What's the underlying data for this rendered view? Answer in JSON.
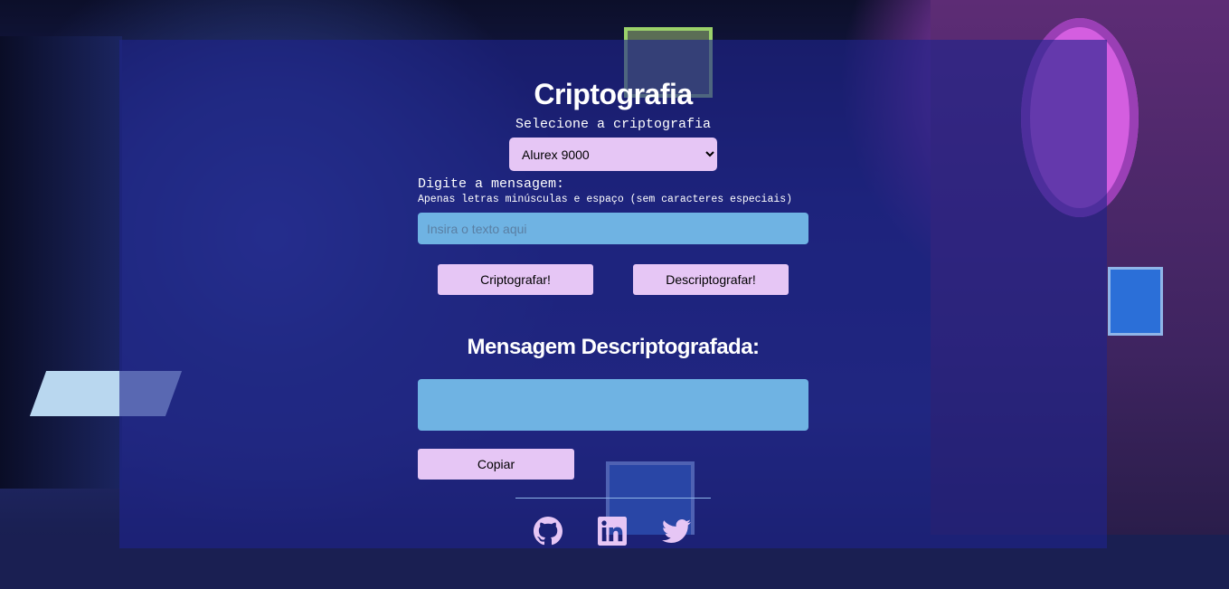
{
  "header": {
    "title": "Criptografia",
    "select_label": "Selecione a criptografia"
  },
  "cipher_select": {
    "selected": "Alurex 9000",
    "options": [
      "Alurex 9000"
    ]
  },
  "message": {
    "label": "Digite a mensagem:",
    "hint": "Apenas letras minúsculas e espaço (sem caracteres especiais)",
    "placeholder": "Insira o texto aqui",
    "value": ""
  },
  "actions": {
    "encrypt_label": "Criptografar!",
    "decrypt_label": "Descriptografar!"
  },
  "result": {
    "title": "Mensagem Descriptografada:",
    "value": "",
    "copy_label": "Copiar"
  },
  "footer": {
    "icons": [
      "github-icon",
      "linkedin-icon",
      "twitter-icon"
    ],
    "icon_color": "#e6c6f5"
  },
  "colors": {
    "accent": "#e6c6f5",
    "field": "#6fb3e3",
    "panel": "#1e248c"
  }
}
